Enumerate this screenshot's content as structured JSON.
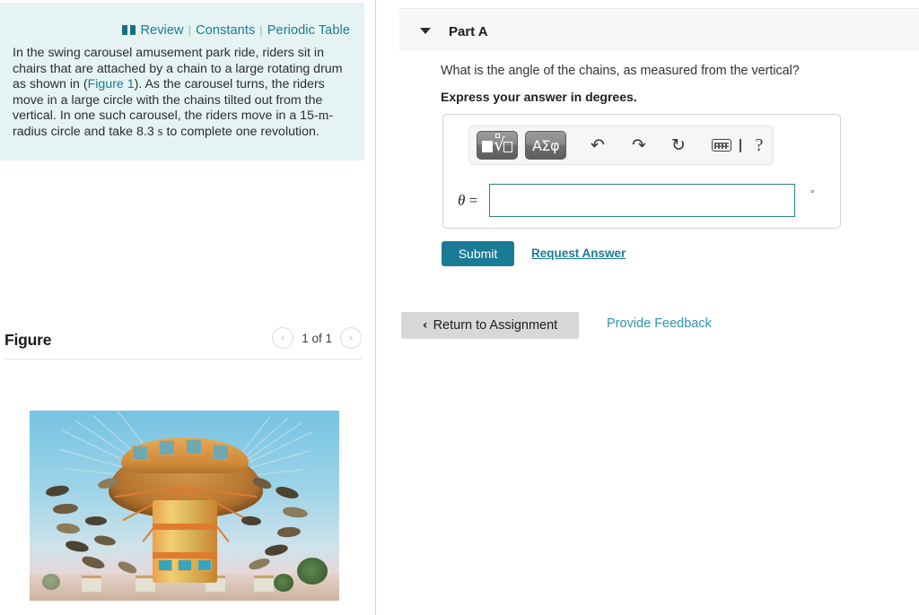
{
  "left": {
    "resources": {
      "book_icon": "book-icon",
      "review": "Review",
      "constants": "Constants",
      "periodic_table": "Periodic Table",
      "separator": "|"
    },
    "problem": {
      "text_part1": "In the swing carousel amusement park ride, riders sit in chairs that are attached by a chain to a large rotating drum as shown in (",
      "figure_link": "Figure 1",
      "text_part2": "). As the carousel turns, the riders move in a large circle with the chains tilted out from the vertical. In one such carousel, the riders move in a ",
      "radius_value": "15-",
      "radius_unit": "m",
      "text_part3": "-radius circle and take 8.3 ",
      "time_unit": "s",
      "text_part4": " to complete one revolution."
    },
    "figure": {
      "title": "Figure",
      "count_label": "1 of 1",
      "prev_icon": "‹",
      "next_icon": "›",
      "image_alt": "swing carousel amusement park ride"
    }
  },
  "right": {
    "part": {
      "title": "Part A",
      "caret_icon": "chevron-down-icon"
    },
    "question": "What is the angle of the chains, as measured from the vertical?",
    "instruction": "Express your answer in degrees.",
    "toolbar": {
      "template_button": "math-template",
      "greek_button": "ΑΣφ",
      "undo_icon": "↶",
      "redo_icon": "↷",
      "reset_icon": "↻",
      "keyboard_icon": "keyboard-icon",
      "help_icon": "?"
    },
    "answer": {
      "variable": "θ",
      "equals": "=",
      "value": "",
      "placeholder": "",
      "unit": "°"
    },
    "submit_label": "Submit",
    "request_answer_label": "Request Answer",
    "return_label": "Return to Assignment",
    "return_chevron": "‹",
    "provide_feedback_label": "Provide Feedback"
  },
  "colors": {
    "teal_panel": "#e6f3f3",
    "link_teal": "#1a7b8c",
    "submit_teal": "#1a7b96",
    "feedback_teal": "#2e93b5",
    "part_band": "#f7f7f7",
    "input_border": "#2d7f96"
  }
}
